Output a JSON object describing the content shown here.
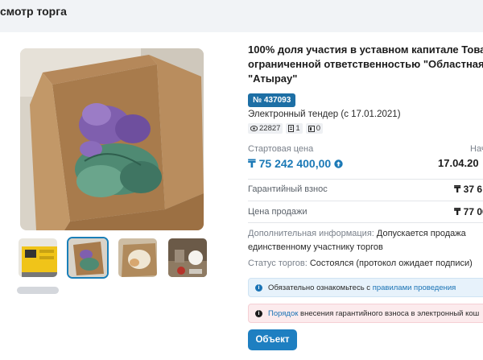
{
  "header": {
    "title": "смотр торга"
  },
  "gallery": {
    "thumbnails": [
      {
        "name": "generator-photo",
        "active": false
      },
      {
        "name": "box-purple-photo",
        "active": true
      },
      {
        "name": "box-cream-photo",
        "active": false
      },
      {
        "name": "table-items-photo",
        "active": false
      }
    ]
  },
  "lot": {
    "title_lines": [
      "100% доля участия в уставном капитале Товари",
      "ограниченной ответственностью \"Областная ф",
      "\"Атырау\""
    ],
    "number": "№ 437093",
    "tender_type": "Электронный тендер (с 17.01.2021)",
    "stats": {
      "views": "22827",
      "docs": "1",
      "bids": "0"
    },
    "start_price_label": "Стартовая цена",
    "start_price": "₸ 75 242 400,00",
    "start_right_label": "Нач",
    "start_right_value": "17.04.20",
    "deposit_label": "Гарантийный взнос",
    "deposit_value": "₸ 37 6",
    "sale_label": "Цена продажи",
    "sale_value": "₸ 77 00",
    "extra_info_label": "Дополнительная информация:",
    "extra_info_value_1": "Допускается продажа",
    "extra_info_value_2": "единственному участнику торгов",
    "status_label": "Статус торгов:",
    "status_value": "Состоялся (протокол ожидает подписи)"
  },
  "alerts": {
    "info_prefix": "Обязательно ознакомьтесь с ",
    "info_link": "правилами проведения",
    "warn_link": "Порядок",
    "warn_suffix": " внесения гарантийного взноса в электронный кош"
  },
  "actions": {
    "object_button": "Объект"
  },
  "colors": {
    "accent": "#1e7fc1",
    "badge": "#1d6fa5",
    "price": "#1b79b6"
  }
}
